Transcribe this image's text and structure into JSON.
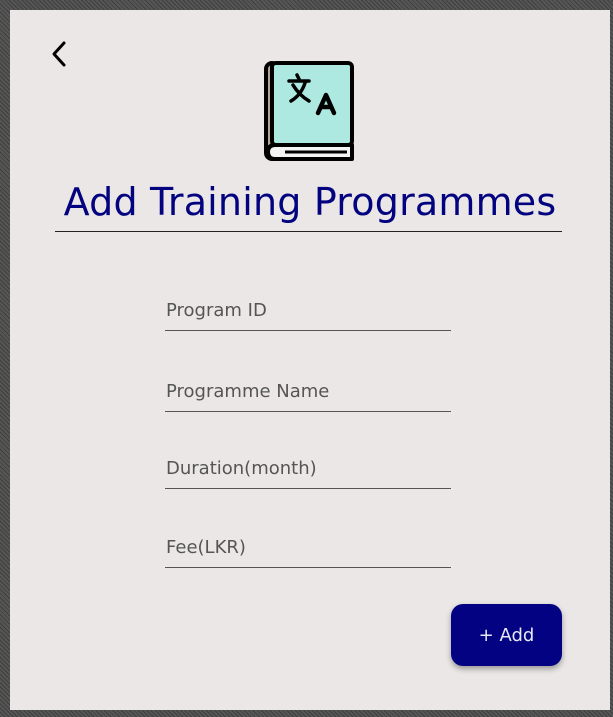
{
  "header": {
    "back_icon": "chevron-left-icon",
    "logo_icon": "translate-book-icon",
    "title": "Add Training Programmes"
  },
  "form": {
    "fields": [
      {
        "placeholder": "Program ID",
        "value": ""
      },
      {
        "placeholder": "Programme Name",
        "value": ""
      },
      {
        "placeholder": "Duration(month)",
        "value": ""
      },
      {
        "placeholder": "Fee(LKR)",
        "value": ""
      }
    ],
    "add_label": "+ Add"
  },
  "colors": {
    "accent": "#020282",
    "title": "#030380",
    "card_background": "#ebe7e7",
    "logo_page": "#aee9e1",
    "logo_spine": "#b9a493"
  }
}
